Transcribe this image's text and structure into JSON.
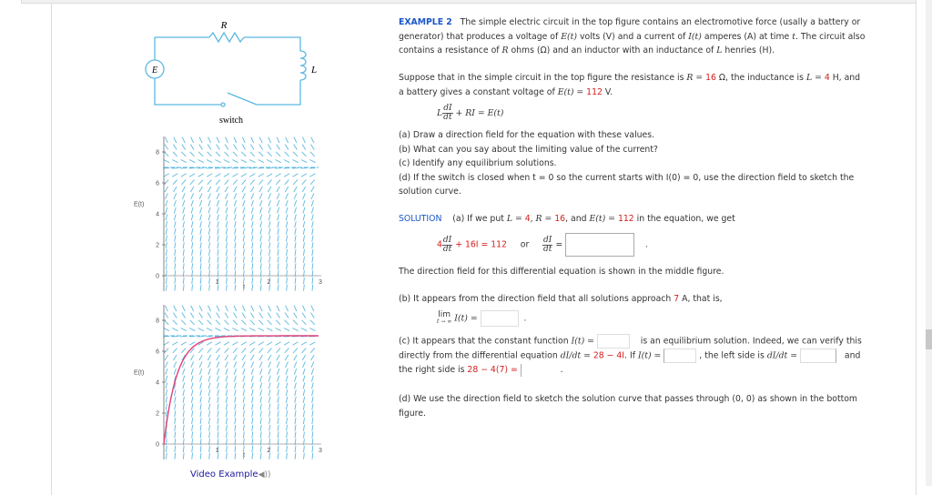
{
  "example": {
    "label": "EXAMPLE 2",
    "intro_1": "The simple electric circuit in the top figure contains an electromotive force (usally a battery or",
    "intro_2a": "generator) that produces a voltage of ",
    "intro_2b": "E(t)",
    "intro_2c": " volts (V) and a current of ",
    "intro_2d": "I(t)",
    "intro_2e": " amperes (A) at time ",
    "intro_2f": "t",
    "intro_2g": ". The circuit also",
    "intro_3a": "contains a resistance of ",
    "intro_3b": "R",
    "intro_3c": " ohms (Ω) and an inductor with an inductance of ",
    "intro_3d": "L",
    "intro_3e": " henries (H)."
  },
  "suppose": {
    "s1": "Suppose that in the simple circuit in the top figure the resistance is ",
    "R_eq": "R = ",
    "R_val": "16",
    "R_unit": " Ω,",
    "s2": " the inductance is ",
    "L_eq": "L = ",
    "L_val": "4",
    "L_unit": " H,",
    "s3": " and",
    "s4": "a battery gives a constant voltage of ",
    "E_eq": "E(t) = ",
    "E_val": "112",
    "E_unit": " V."
  },
  "equation": {
    "L": "L",
    "num": "dI",
    "den": "dt",
    "rest": " + RI = E(t)"
  },
  "questions": [
    "(a) Draw a direction field for the equation with these values.",
    "(b) What can you say about the limiting value of the current?",
    "(c) Identify any equilibrium solutions.",
    "(d) If the switch is closed when  t = 0  so the current starts with  I(0) = 0,  use the direction field to sketch the",
    "solution curve."
  ],
  "solution": {
    "label": "SOLUTION",
    "a_1": "(a) If we put ",
    "a_L": "L = ",
    "a_Lval": "4",
    "a_R": ",   R = ",
    "a_Rval": "16",
    "a_and": ",  and ",
    "a_E": "E(t) = ",
    "a_Eval": "112",
    "a_2": "  in the equation, we get",
    "eq_coef": "4",
    "eq_num": "dI",
    "eq_den": "dt",
    "eq_mid": " + 16I = 112",
    "eq_or": "or",
    "eq_eq": " =",
    "eq_period": ".",
    "dirfield_text": "The direction field for this differential equation is shown in the middle figure.",
    "b_1": "(b) It appears from the direction field that all solutions approach ",
    "b_val": "7",
    "b_2": " A, that is,",
    "lim_top": "lim",
    "lim_sub": "t → ∞",
    "lim_fn": "I(t) =",
    "lim_period": ".",
    "c_1": "(c) It appears that the constant function ",
    "c_fn": "I(t) =",
    "c_2": "is an equilibrium solution. Indeed, we can verify this",
    "c_3": "directly from the differential equation ",
    "c_de": "dI/dt = ",
    "c_de_val": "28 − 4I",
    "c_4": ".  If ",
    "c_if": "I(t) =",
    "c_5": ", the left side is ",
    "c_lhs": "dI/dt =",
    "c_and": "and",
    "c_6": "the right side is ",
    "c_rhs": "28 − 4(7) =",
    "c_period": ".",
    "d_1": "(d) We use the direction field to sketch the solution curve that passes through  (0, 0)  as shown in the bottom",
    "d_2": "figure."
  },
  "answers": {
    "dIdt": "",
    "limit": "",
    "equilibrium": "",
    "if_I": "",
    "lhs": "",
    "rhs": ""
  },
  "circuit": {
    "R_label": "R",
    "L_label": "L",
    "E_label": "E",
    "switch_label": "switch"
  },
  "video_link": "Video Example",
  "colors": {
    "accent_blue": "#1a56c9",
    "highlight_red": "#d61c1c",
    "field_blue": "#5bb8e0",
    "solution_curve": "#e0407a"
  },
  "chart_data": [
    {
      "type": "direction-field",
      "title": "",
      "equation": "dI/dt = 28 - 4I",
      "xlabel": "t",
      "ylabel": "E(t)",
      "xlim": [
        0,
        3
      ],
      "ylim": [
        -1,
        9
      ],
      "xticks": [
        "1",
        "2",
        "3"
      ],
      "yticks": [
        "0",
        "2",
        "4",
        "6",
        "8"
      ],
      "equilibrium": 7
    },
    {
      "type": "direction-field",
      "title": "",
      "equation": "dI/dt = 28 - 4I",
      "xlabel": "t",
      "ylabel": "E(t)",
      "xlim": [
        0,
        3
      ],
      "ylim": [
        -1,
        9
      ],
      "xticks": [
        "1",
        "2",
        "3"
      ],
      "yticks": [
        "0",
        "2",
        "4",
        "6",
        "8"
      ],
      "equilibrium": 7,
      "solution_curve": {
        "initial": [
          0,
          0
        ],
        "formula": "I(t) = 7(1 - e^(-4t))"
      }
    }
  ]
}
